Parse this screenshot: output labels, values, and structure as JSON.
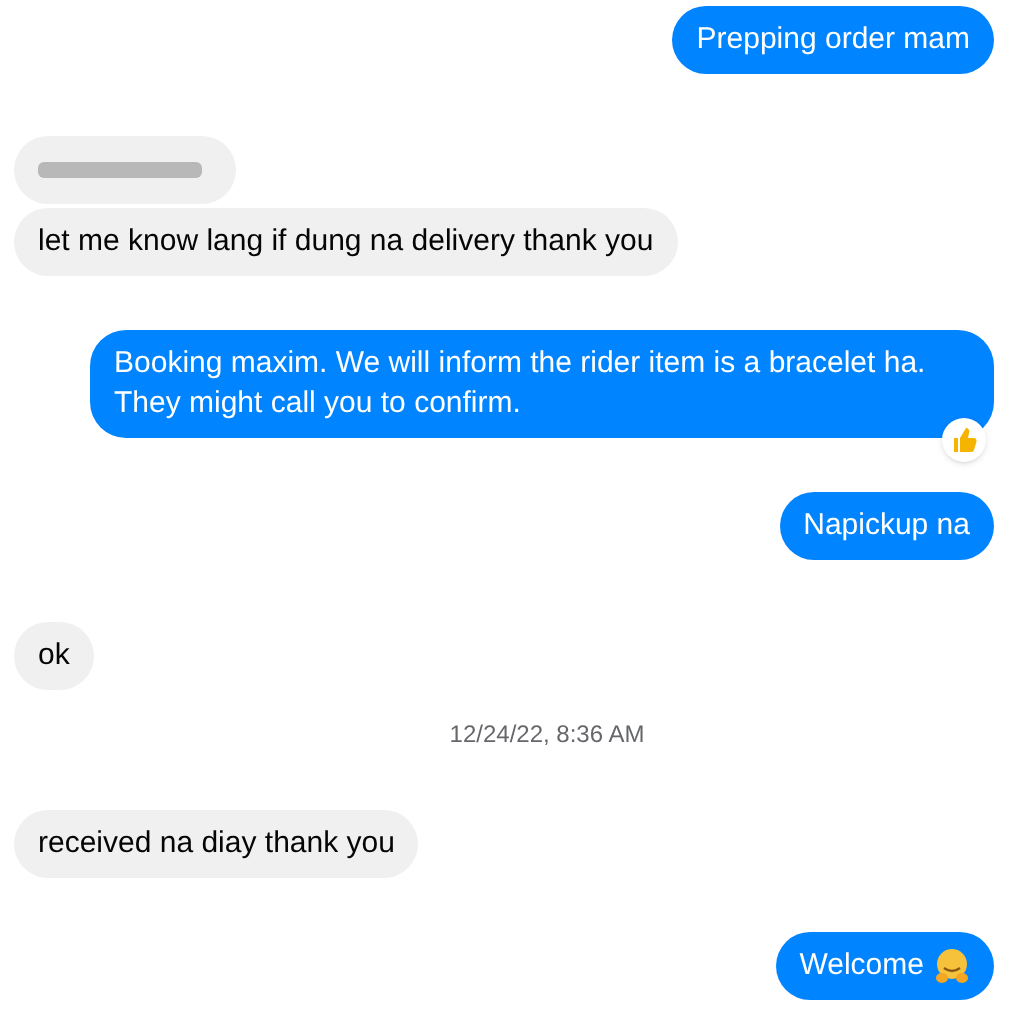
{
  "groups": [
    {
      "kind": "outgoing",
      "bubbles": [
        {
          "text": "Prepping order mam"
        }
      ]
    },
    {
      "kind": "incoming",
      "bubbles": [
        {
          "kind": "redacted"
        },
        {
          "text": "let me know lang if dung na delivery thank you"
        }
      ]
    },
    {
      "kind": "outgoing",
      "bubbles": [
        {
          "text": "Booking maxim. We will inform the rider item is a bracelet ha. They might call you to confirm.",
          "reacted": true
        }
      ]
    },
    {
      "kind": "outgoing",
      "bubbles": [
        {
          "text": "Napickup na"
        }
      ]
    },
    {
      "kind": "incoming",
      "bubbles": [
        {
          "text": "ok"
        }
      ]
    },
    {
      "kind": "timestamp",
      "text": "12/24/22, 8:36 AM"
    },
    {
      "kind": "incoming",
      "bubbles": [
        {
          "text": "received na diay thank you"
        }
      ]
    },
    {
      "kind": "outgoing",
      "bubbles": [
        {
          "text": "Welcome",
          "emoji": true
        }
      ]
    }
  ]
}
